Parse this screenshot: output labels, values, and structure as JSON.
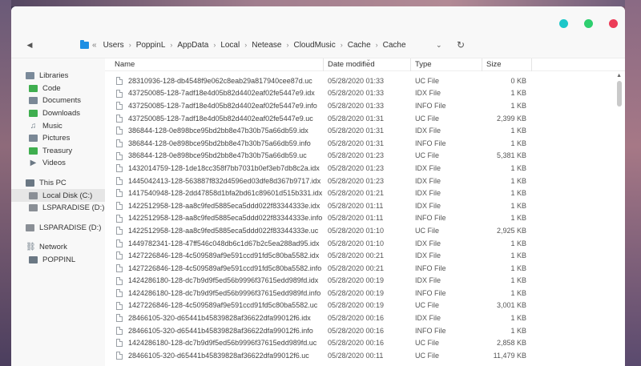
{
  "window": {
    "controls": [
      "minimize",
      "maximize",
      "close"
    ],
    "colors": {
      "teal": "#1cc7c9",
      "green": "#2ecf6f",
      "red": "#ec3c58"
    }
  },
  "address": {
    "back_icon": "chevron-left-icon",
    "overflow": "«",
    "crumbs": [
      "Users",
      "PoppinL",
      "AppData",
      "Local",
      "Netease",
      "CloudMusic",
      "Cache",
      "Cache"
    ],
    "separator": "›"
  },
  "sidebar": {
    "items": [
      {
        "label": "Libraries",
        "icon": "libraries-icon"
      },
      {
        "label": "Code",
        "icon": "folder-icon"
      },
      {
        "label": "Documents",
        "icon": "documents-icon"
      },
      {
        "label": "Downloads",
        "icon": "downloads-icon"
      },
      {
        "label": "Music",
        "icon": "music-icon"
      },
      {
        "label": "Pictures",
        "icon": "pictures-icon"
      },
      {
        "label": "Treasury",
        "icon": "folder-icon"
      },
      {
        "label": "Videos",
        "icon": "videos-icon"
      },
      {
        "label": "This PC",
        "icon": "pc-icon"
      },
      {
        "label": "Local Disk (C:)",
        "icon": "drive-icon"
      },
      {
        "label": "LSPARADISE (D:)",
        "icon": "drive-icon"
      },
      {
        "label": "LSPARADISE (D:)",
        "icon": "drive-icon"
      },
      {
        "label": "Network",
        "icon": "network-icon"
      },
      {
        "label": "POPPINL",
        "icon": "computer-icon"
      }
    ]
  },
  "columns": {
    "name": "Name",
    "date": "Date modified",
    "type": "Type",
    "size": "Size"
  },
  "files": [
    {
      "name": "28310936-128-db4548f9e062c8eab29a817940cee87d.uc",
      "date": "05/28/2020 01:33",
      "type": "UC File",
      "size": "0 KB"
    },
    {
      "name": "437250085-128-7adf18e4d05b82d4402eaf02fe5447e9.idx",
      "date": "05/28/2020 01:33",
      "type": "IDX File",
      "size": "1 KB"
    },
    {
      "name": "437250085-128-7adf18e4d05b82d4402eaf02fe5447e9.info",
      "date": "05/28/2020 01:33",
      "type": "INFO File",
      "size": "1 KB"
    },
    {
      "name": "437250085-128-7adf18e4d05b82d4402eaf02fe5447e9.uc",
      "date": "05/28/2020 01:31",
      "type": "UC File",
      "size": "2,399 KB"
    },
    {
      "name": "386844-128-0e898bce95bd2bb8e47b30b75a66db59.idx",
      "date": "05/28/2020 01:31",
      "type": "IDX File",
      "size": "1 KB"
    },
    {
      "name": "386844-128-0e898bce95bd2bb8e47b30b75a66db59.info",
      "date": "05/28/2020 01:31",
      "type": "INFO File",
      "size": "1 KB"
    },
    {
      "name": "386844-128-0e898bce95bd2bb8e47b30b75a66db59.uc",
      "date": "05/28/2020 01:23",
      "type": "UC File",
      "size": "5,381 KB"
    },
    {
      "name": "1432014759-128-1de18cc358f7bb7031b0ef3eb7db8c2a.idx",
      "date": "05/28/2020 01:23",
      "type": "IDX File",
      "size": "1 KB"
    },
    {
      "name": "1445042413-128-563887f832d4596ed03dfe8d367b9717.idx",
      "date": "05/28/2020 01:23",
      "type": "IDX File",
      "size": "1 KB"
    },
    {
      "name": "1417540948-128-2dd47858d1bfa2bd61c89601d515b331.idx",
      "date": "05/28/2020 01:21",
      "type": "IDX File",
      "size": "1 KB"
    },
    {
      "name": "1422512958-128-aa8c9fed5885eca5ddd022f83344333e.idx",
      "date": "05/28/2020 01:11",
      "type": "IDX File",
      "size": "1 KB"
    },
    {
      "name": "1422512958-128-aa8c9fed5885eca5ddd022f83344333e.info",
      "date": "05/28/2020 01:11",
      "type": "INFO File",
      "size": "1 KB"
    },
    {
      "name": "1422512958-128-aa8c9fed5885eca5ddd022f83344333e.uc",
      "date": "05/28/2020 01:10",
      "type": "UC File",
      "size": "2,925 KB"
    },
    {
      "name": "1449782341-128-47ff546c048db6c1d67b2c5ea288ad95.idx",
      "date": "05/28/2020 01:10",
      "type": "IDX File",
      "size": "1 KB"
    },
    {
      "name": "1427226846-128-4c509589af9e591ccd91fd5c80ba5582.idx",
      "date": "05/28/2020 00:21",
      "type": "IDX File",
      "size": "1 KB"
    },
    {
      "name": "1427226846-128-4c509589af9e591ccd91fd5c80ba5582.info",
      "date": "05/28/2020 00:21",
      "type": "INFO File",
      "size": "1 KB"
    },
    {
      "name": "1424286180-128-dc7b9d9f5ed56b9996f37615edd989fd.idx",
      "date": "05/28/2020 00:19",
      "type": "IDX File",
      "size": "1 KB"
    },
    {
      "name": "1424286180-128-dc7b9d9f5ed56b9996f37615edd989fd.info",
      "date": "05/28/2020 00:19",
      "type": "INFO File",
      "size": "1 KB"
    },
    {
      "name": "1427226846-128-4c509589af9e591ccd91fd5c80ba5582.uc",
      "date": "05/28/2020 00:19",
      "type": "UC File",
      "size": "3,001 KB"
    },
    {
      "name": "28466105-320-d65441b45839828af36622dfa99012f6.idx",
      "date": "05/28/2020 00:16",
      "type": "IDX File",
      "size": "1 KB"
    },
    {
      "name": "28466105-320-d65441b45839828af36622dfa99012f6.info",
      "date": "05/28/2020 00:16",
      "type": "INFO File",
      "size": "1 KB"
    },
    {
      "name": "1424286180-128-dc7b9d9f5ed56b9996f37615edd989fd.uc",
      "date": "05/28/2020 00:16",
      "type": "UC File",
      "size": "2,858 KB"
    },
    {
      "name": "28466105-320-d65441b45839828af36622dfa99012f6.uc",
      "date": "05/28/2020 00:11",
      "type": "UC File",
      "size": "11,479 KB"
    }
  ]
}
